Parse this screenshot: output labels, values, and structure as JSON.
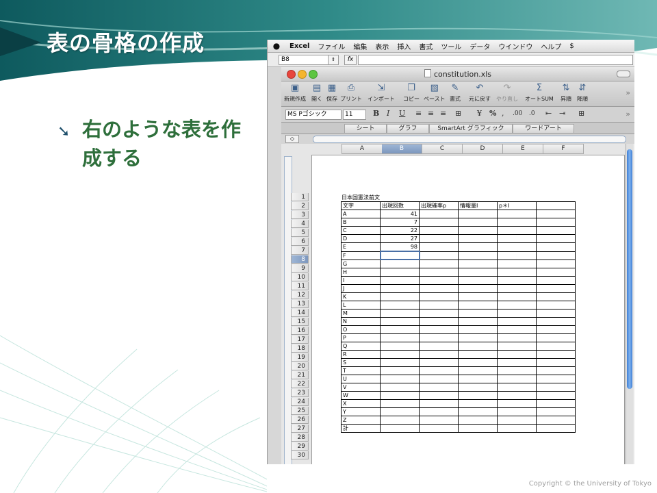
{
  "slide": {
    "title": "表の骨格の作成",
    "bullet": "右のような表を作成する",
    "copyright": "Copyright © the University of Tokyo"
  },
  "excel": {
    "menu": [
      "Excel",
      "ファイル",
      "編集",
      "表示",
      "挿入",
      "書式",
      "ツール",
      "データ",
      "ウインドウ",
      "ヘルプ"
    ],
    "name_box": "B8",
    "fx_label": "fx",
    "window_title": "constitution.xls",
    "toolbar": [
      {
        "icon": "new-workbook-icon",
        "label": "新規作成"
      },
      {
        "icon": "open-icon",
        "label": "開く"
      },
      {
        "icon": "save-icon",
        "label": "保存"
      },
      {
        "icon": "print-icon",
        "label": "プリント"
      },
      {
        "icon": "import-icon",
        "label": "インポート"
      },
      {
        "icon": "copy-icon",
        "label": "コピー"
      },
      {
        "icon": "paste-icon",
        "label": "ペースト"
      },
      {
        "icon": "format-brush-icon",
        "label": "書式"
      },
      {
        "icon": "undo-icon",
        "label": "元に戻す"
      },
      {
        "icon": "redo-icon",
        "label": "やり直し"
      },
      {
        "icon": "autosum-icon",
        "label": "オートSUM"
      },
      {
        "icon": "sort-ascending-icon",
        "label": "昇順"
      },
      {
        "icon": "sort-descending-icon",
        "label": "降順"
      }
    ],
    "font_name": "MS Pゴシック",
    "font_size": "11",
    "ribbon_tabs": [
      "シート",
      "グラフ",
      "SmartArt グラフィック",
      "ワードアート"
    ],
    "columns": [
      "A",
      "B",
      "C",
      "D",
      "E",
      "F"
    ],
    "selected_column": "B",
    "selected_row": "8",
    "row_numbers": [
      "1",
      "2",
      "3",
      "4",
      "5",
      "6",
      "7",
      "8",
      "9",
      "10",
      "11",
      "12",
      "13",
      "14",
      "15",
      "16",
      "17",
      "18",
      "19",
      "20",
      "21",
      "22",
      "23",
      "24",
      "25",
      "26",
      "27",
      "28",
      "29",
      "30"
    ],
    "sheet_title": "日本国憲法前文",
    "headers": [
      "文字",
      "出現回数",
      "出現確率p",
      "情報量I",
      "p＊I",
      ""
    ],
    "rows": [
      [
        "A",
        "41"
      ],
      [
        "B",
        "7"
      ],
      [
        "C",
        "22"
      ],
      [
        "D",
        "27"
      ],
      [
        "E",
        "98"
      ],
      [
        "F",
        ""
      ],
      [
        "G",
        ""
      ],
      [
        "H",
        ""
      ],
      [
        "I",
        ""
      ],
      [
        "J",
        ""
      ],
      [
        "K",
        ""
      ],
      [
        "L",
        ""
      ],
      [
        "M",
        ""
      ],
      [
        "N",
        ""
      ],
      [
        "O",
        ""
      ],
      [
        "P",
        ""
      ],
      [
        "Q",
        ""
      ],
      [
        "R",
        ""
      ],
      [
        "S",
        ""
      ],
      [
        "T",
        ""
      ],
      [
        "U",
        ""
      ],
      [
        "V",
        ""
      ],
      [
        "W",
        ""
      ],
      [
        "X",
        ""
      ],
      [
        "Y",
        ""
      ],
      [
        "Z",
        ""
      ],
      [
        "計",
        ""
      ]
    ],
    "colors": {
      "selection": "#7d97bd",
      "scroll_thumb": "#3d7ed6"
    }
  }
}
